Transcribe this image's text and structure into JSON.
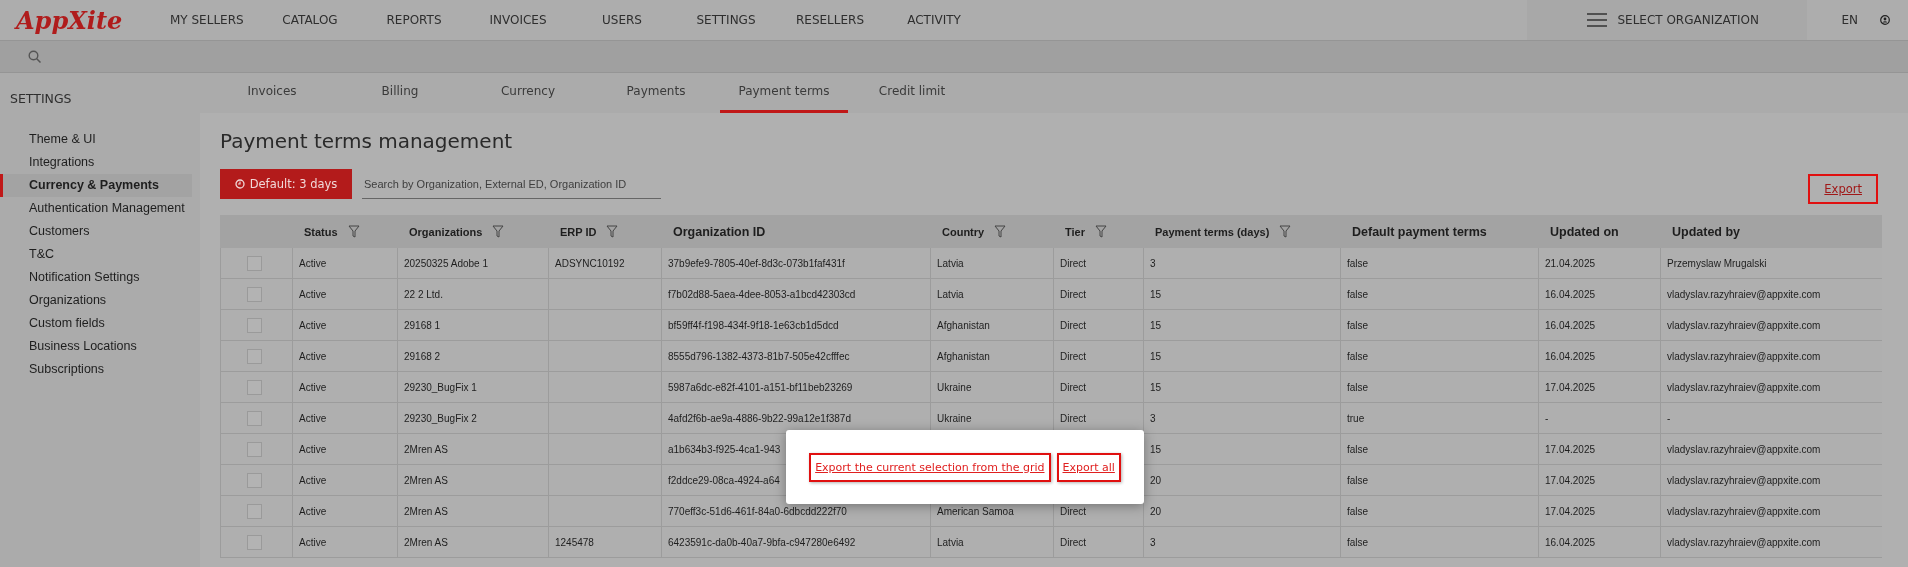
{
  "logo": "AppXite",
  "nav": [
    {
      "label": "MY SELLERS",
      "selected": false
    },
    {
      "label": "CATALOG",
      "selected": false
    },
    {
      "label": "REPORTS",
      "selected": false
    },
    {
      "label": "INVOICES",
      "selected": false
    },
    {
      "label": "USERS",
      "selected": false
    },
    {
      "label": "SETTINGS",
      "selected": false
    },
    {
      "label": "RESELLERS",
      "selected": false
    },
    {
      "label": "ACTIVITY",
      "selected": false
    }
  ],
  "org_selector": "SELECT ORGANIZATION",
  "language": "EN",
  "sidebar": {
    "title": "SETTINGS",
    "items": [
      {
        "label": "Theme & UI",
        "selected": false
      },
      {
        "label": "Integrations",
        "selected": false
      },
      {
        "label": "Currency & Payments",
        "selected": true
      },
      {
        "label": "Authentication Management",
        "selected": false
      },
      {
        "label": "Customers",
        "selected": false
      },
      {
        "label": "T&C",
        "selected": false
      },
      {
        "label": "Notification Settings",
        "selected": false
      },
      {
        "label": "Organizations",
        "selected": false
      },
      {
        "label": "Custom fields",
        "selected": false
      },
      {
        "label": "Business Locations",
        "selected": false
      },
      {
        "label": "Subscriptions",
        "selected": false
      }
    ]
  },
  "tabs": [
    {
      "label": "Invoices",
      "selected": false
    },
    {
      "label": "Billing",
      "selected": false
    },
    {
      "label": "Currency",
      "selected": false
    },
    {
      "label": "Payments",
      "selected": false
    },
    {
      "label": "Payment terms",
      "selected": true
    },
    {
      "label": "Credit limit",
      "selected": false
    }
  ],
  "title": "Payment terms management",
  "default_button": "Default: 3 days",
  "search": {
    "placeholder": "Search by Organization, External ED, Organization ID"
  },
  "export_link": "Export",
  "table": {
    "columns": [
      {
        "label": "Status",
        "filter": true
      },
      {
        "label": "Organizations",
        "filter": true
      },
      {
        "label": "ERP ID",
        "filter": true
      },
      {
        "label": "Organization ID",
        "filter": false
      },
      {
        "label": "Country",
        "filter": true
      },
      {
        "label": "Tier",
        "filter": true
      },
      {
        "label": "Payment terms (days)",
        "filter": true
      },
      {
        "label": "Default payment terms",
        "filter": false
      },
      {
        "label": "Updated on",
        "filter": false
      },
      {
        "label": "Updated by",
        "filter": false
      }
    ],
    "rows": [
      {
        "checked": false,
        "cells": [
          "Active",
          "20250325 Adobe 1",
          "ADSYNC10192",
          "37b9efe9-7805-40ef-8d3c-073b1faf431f",
          "Latvia",
          "Direct",
          "3",
          "false",
          "21.04.2025",
          "Przemyslaw Mrugalski"
        ]
      },
      {
        "checked": false,
        "cells": [
          "Active",
          "22 2 Ltd.",
          "",
          "f7b02d88-5aea-4dee-8053-a1bcd42303cd",
          "Latvia",
          "Direct",
          "15",
          "false",
          "16.04.2025",
          "vladyslav.razyhraiev@appxite.com"
        ]
      },
      {
        "checked": false,
        "cells": [
          "Active",
          "29168 1",
          "",
          "bf59ff4f-f198-434f-9f18-1e63cb1d5dcd",
          "Afghanistan",
          "Direct",
          "15",
          "false",
          "16.04.2025",
          "vladyslav.razyhraiev@appxite.com"
        ]
      },
      {
        "checked": false,
        "cells": [
          "Active",
          "29168 2",
          "",
          "8555d796-1382-4373-81b7-505e42cfffec",
          "Afghanistan",
          "Direct",
          "15",
          "false",
          "16.04.2025",
          "vladyslav.razyhraiev@appxite.com"
        ]
      },
      {
        "checked": false,
        "cells": [
          "Active",
          "29230_BugFix 1",
          "",
          "5987a6dc-e82f-4101-a151-bf11beb23269",
          "Ukraine",
          "Direct",
          "15",
          "false",
          "17.04.2025",
          "vladyslav.razyhraiev@appxite.com"
        ]
      },
      {
        "checked": false,
        "cells": [
          "Active",
          "29230_BugFix 2",
          "",
          "4afd2f6b-ae9a-4886-9b22-99a12e1f387d",
          "Ukraine",
          "Direct",
          "3",
          "true",
          "-",
          "-"
        ]
      },
      {
        "checked": false,
        "cells": [
          "Active",
          "2Mren AS",
          "",
          "a1b634b3-f925-4ca1-943",
          null,
          null,
          "15",
          "false",
          "17.04.2025",
          "vladyslav.razyhraiev@appxite.com"
        ]
      },
      {
        "checked": false,
        "cells": [
          "Active",
          "2Mren AS",
          "",
          "f2ddce29-08ca-4924-a64",
          null,
          null,
          "20",
          "false",
          "17.04.2025",
          "vladyslav.razyhraiev@appxite.com"
        ]
      },
      {
        "checked": false,
        "cells": [
          "Active",
          "2Mren AS",
          "",
          "770eff3c-51d6-461f-84a0-6dbcdd222f70",
          "American Samoa",
          "Direct",
          "20",
          "false",
          "17.04.2025",
          "vladyslav.razyhraiev@appxite.com"
        ]
      },
      {
        "checked": false,
        "cells": [
          "Active",
          "2Mren AS",
          "1245478",
          "6423591c-da0b-40a7-9bfa-c947280e6492",
          "Latvia",
          "Direct",
          "3",
          "false",
          "16.04.2025",
          "vladyslav.razyhraiev@appxite.com"
        ]
      }
    ]
  },
  "export_popup": {
    "options": [
      "Export the current selection from the grid",
      "Export all"
    ]
  }
}
